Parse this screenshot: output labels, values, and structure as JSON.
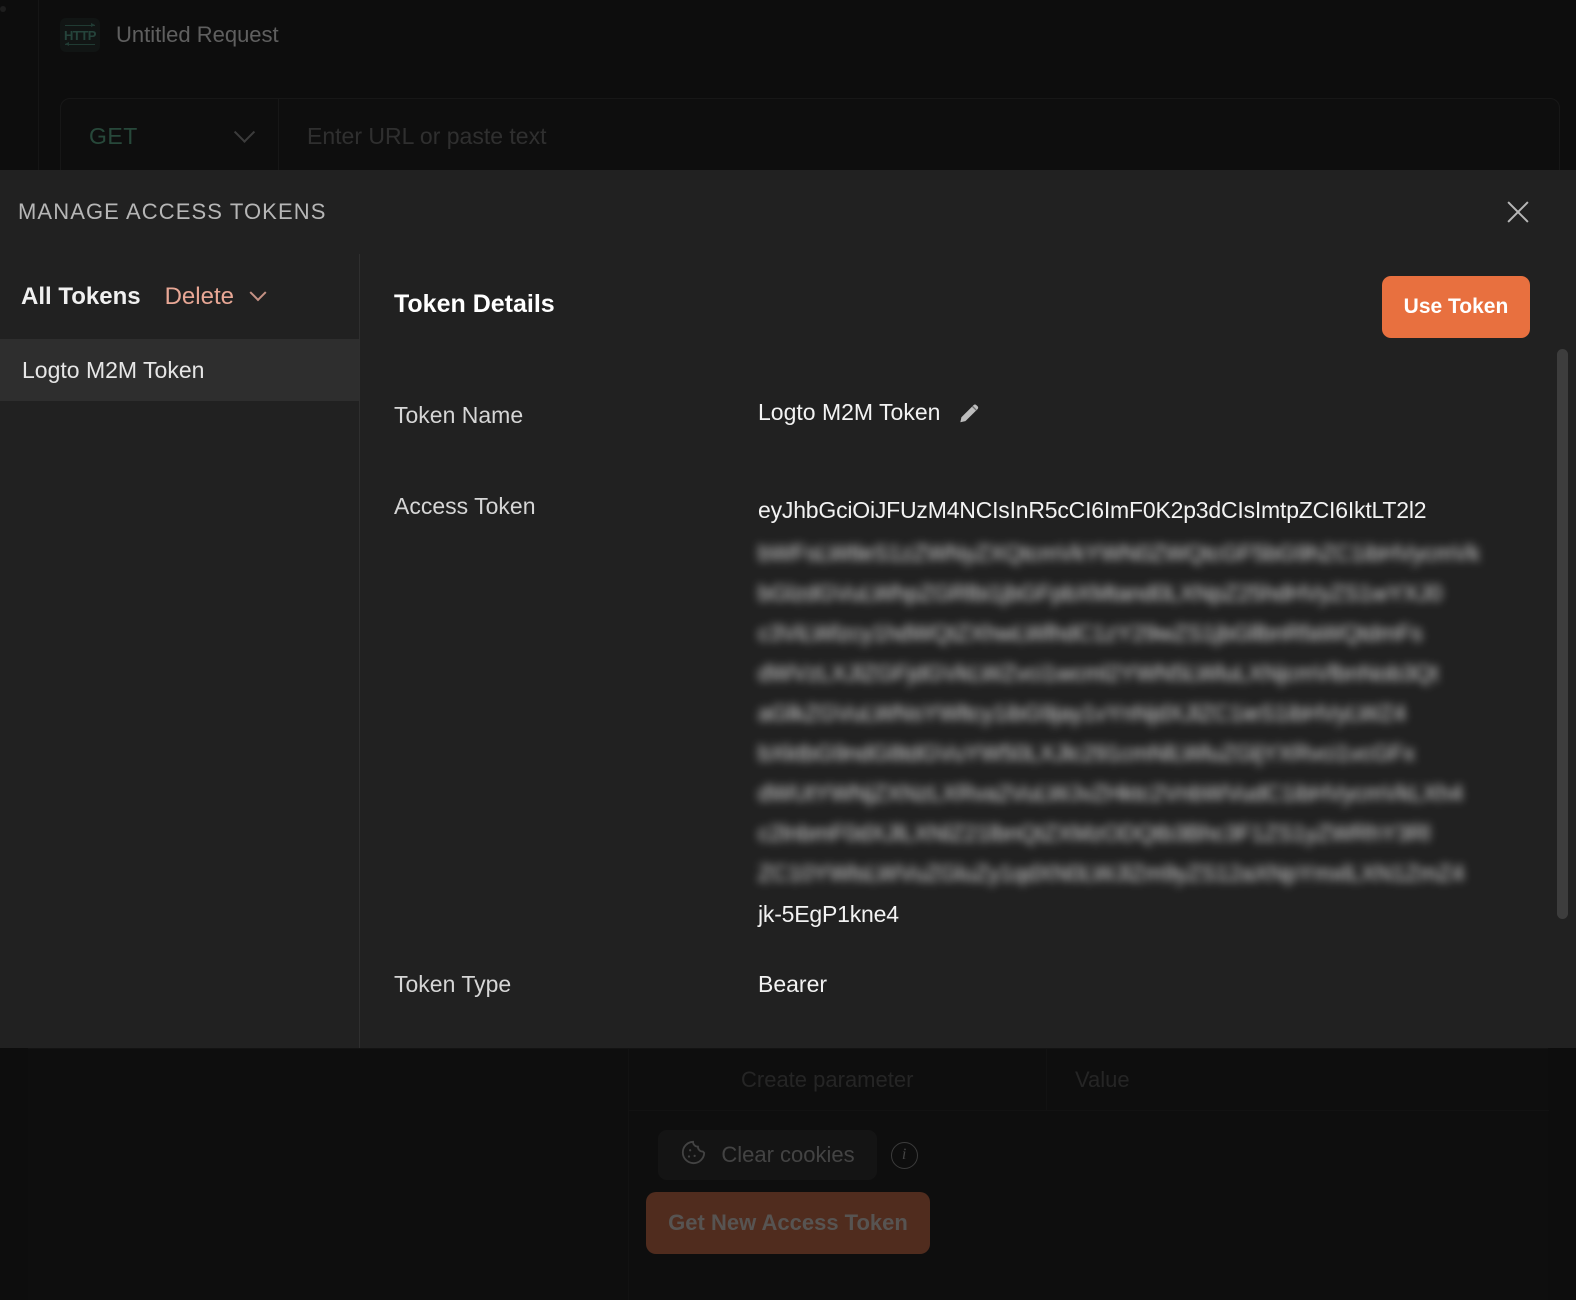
{
  "background": {
    "tab": {
      "title": "Untitled Request",
      "icon_label": "HTTP"
    },
    "url_bar": {
      "method": "GET",
      "url_placeholder": "Enter URL or paste text"
    },
    "params_table": {
      "name_placeholder": "Create parameter",
      "value_placeholder": "Value"
    },
    "actions": {
      "clear_cookies_label": "Clear cookies",
      "info_glyph": "i",
      "get_new_token_label": "Get New Access Token"
    }
  },
  "modal": {
    "title": "MANAGE ACCESS TOKENS",
    "close_label": "×",
    "sidebar": {
      "title": "All Tokens",
      "delete_label": "Delete",
      "items": [
        {
          "label": "Logto M2M Token",
          "selected": true
        }
      ]
    },
    "detail": {
      "title": "Token Details",
      "use_token_label": "Use Token",
      "fields": {
        "token_name_label": "Token Name",
        "token_name_value": "Logto M2M Token",
        "access_token_label": "Access Token",
        "access_token_first_line": "eyJhbGciOiJFUzM4NCIsInR5cCI6ImF0K2p3dCIsImtpZCI6IktLT2l2",
        "access_token_redacted_lines": [
          "bWFsLWtleS1zZWNyZXQtcmVkYWN0ZWQtcGF5bG9hZC1ibHVycmVk",
          "bGlzdGVuLWhpZGRlbi1jbGFpbXMtand0LXNpZ25hdHVyZS1wYXJ0",
          "c3ViLWlzcy1hdWQtZXhwLWlhdC1zY29wZS1jbGllbnRfaWQtdmFs",
          "dWVzLXJlZGFjdGVkLWZvci1wcml2YWN5LWluLXNjcmVlbnNob3Qt",
          "aGlkZGVuLWNsYWltcy1ibG9jay1vYnNjdXJlZC1ieS1ibHVyLWZ4",
          "bXktbG9ndG8tdGVuYW50LXJlc291cmNlLWluZGljYXRvci1vcGFx",
          "dWUtYWNjZXNzLXRva2VuLWJvZHktc2VnbWVudC1ibHVycmVkLXh4",
          "c2lnbmF0dXJlLXNlZ21lbnQtZXMzODQtb3Bhc3F1ZS1yZWRhY3Rl",
          "ZC10YWlsLWVuZGluZy1qdXN0LWJlZm9yZS12aXNpYmxlLXN1ZmZ4"
        ],
        "access_token_last_line": "jk-5EgP1kne4",
        "token_type_label": "Token Type",
        "token_type_value": "Bearer"
      }
    }
  },
  "colors": {
    "accent_orange": "#e8703f",
    "accent_orange_dim": "#a8593b",
    "delete_text": "#e8a795",
    "method_green": "#4f9878",
    "modal_bg": "#212121",
    "app_bg": "#151515"
  }
}
